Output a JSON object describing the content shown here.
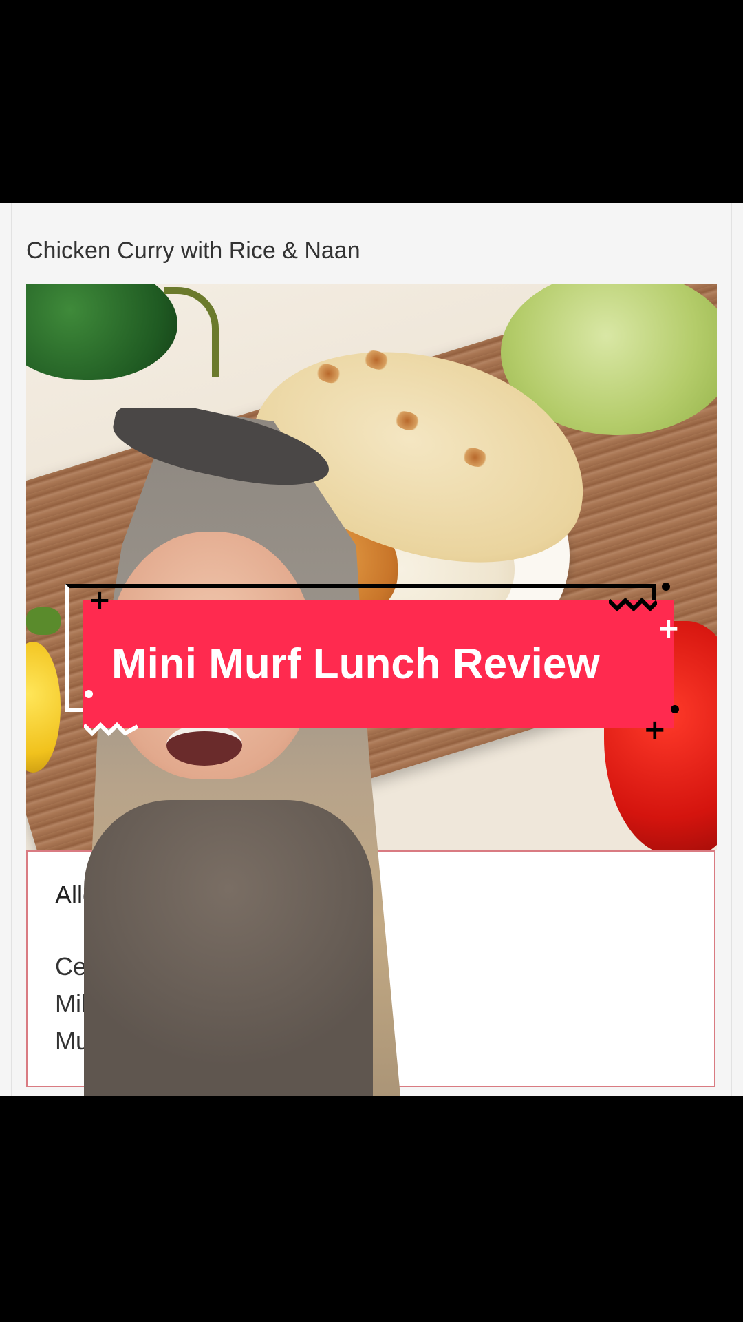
{
  "recipe": {
    "title": "Chicken Curry with Rice & Naan"
  },
  "allergens": {
    "heading": "Alle",
    "items": [
      "Ce",
      "Mil",
      "Mu"
    ]
  },
  "overlay": {
    "banner_text": "Mini Murf Lunch Review",
    "banner_color": "#ff2a4f"
  },
  "colors": {
    "background": "#000000",
    "card": "#f5f5f5",
    "allergen_border": "#d97b82"
  }
}
